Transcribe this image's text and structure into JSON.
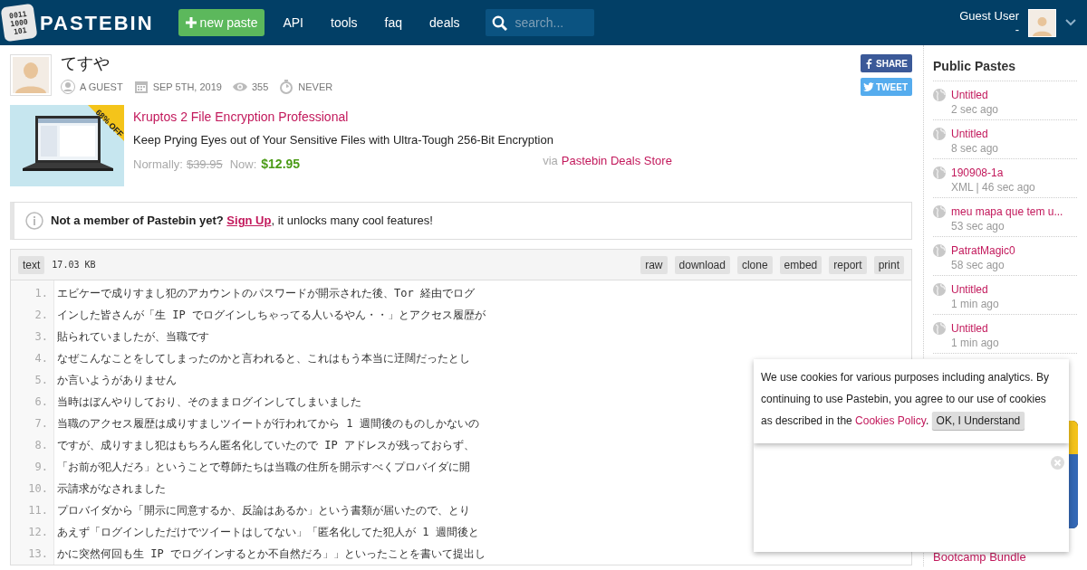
{
  "header": {
    "logo_icon_text": [
      "0011",
      "1000",
      "101"
    ],
    "logo": "PASTEBIN",
    "new_paste": "new paste",
    "nav": [
      "API",
      "tools",
      "faq",
      "deals"
    ],
    "search": {
      "placeholder": "search..."
    },
    "user": {
      "name": "Guest User",
      "sub": "-"
    }
  },
  "paste": {
    "title": "てすや",
    "meta": [
      {
        "kind": "user",
        "text": "A GUEST"
      },
      {
        "kind": "date",
        "text": "SEP 5TH, 2019"
      },
      {
        "kind": "views",
        "text": "355"
      },
      {
        "kind": "expire",
        "text": "NEVER"
      }
    ],
    "share": [
      {
        "kind": "facebook",
        "label": "SHARE"
      },
      {
        "kind": "twitter",
        "label": "TWEET"
      }
    ]
  },
  "deal": {
    "badge": "68% OFF",
    "title": "Kruptos 2 File Encryption Professional",
    "subtitle": "Keep Prying Eyes out of Your Sensitive Files with Ultra-Tough 256-Bit Encryption",
    "normally_label": "Normally:",
    "old_price": "$39.95",
    "now_label": "Now:",
    "price": "$12.95",
    "via": "via",
    "store": "Pastebin Deals Store"
  },
  "notice": {
    "bold": "Not a member of Pastebin yet?",
    "link": "Sign Up",
    "rest": ", it unlocks many cool features!"
  },
  "code": {
    "syntax": "text",
    "size": "17.03 KB",
    "actions": [
      "raw",
      "download",
      "clone",
      "embed",
      "report",
      "print"
    ],
    "lines": [
      {
        "num": "1.",
        "text": "エビケーで成りすまし犯のアカウントのパスワードが開示された後、Tor 経由でログ"
      },
      {
        "num": "2.",
        "text": "インした皆さんが「生 IP でログインしちゃってる人いるやん・・」とアクセス履歴が"
      },
      {
        "num": "3.",
        "text": "貼られていましたが、当職です"
      },
      {
        "num": "4.",
        "text": "なぜこんなことをしてしまったのかと言われると、これはもう本当に迂闊だったとし"
      },
      {
        "num": "5.",
        "text": "か言いようがありません"
      },
      {
        "num": "6.",
        "text": "当時はぼんやりしており、そのままログインしてしまいました"
      },
      {
        "num": "7.",
        "text": "当職のアクセス履歴は成りすましツイートが行われてから 1 週間後のものしかないの"
      },
      {
        "num": "8.",
        "text": "ですが、成りすまし犯はもちろん匿名化していたので IP アドレスが残っておらず、"
      },
      {
        "num": "9.",
        "text": "「お前が犯人だろ」ということで尊師たちは当職の住所を開示すべくプロバイダに開"
      },
      {
        "num": "10.",
        "text": "示請求がなされました"
      },
      {
        "num": "11.",
        "text": "プロバイダから「開示に同意するか、反論はあるか」という書類が届いたので、とり"
      },
      {
        "num": "12.",
        "text": "あえず「ログインしただけでツイートはしてない」「匿名化してた犯人が 1 週間後と"
      },
      {
        "num": "13.",
        "text": "かに突然何回も生 IP でログインするとか不自然だろ」」といったことを書いて提出し"
      }
    ]
  },
  "sidebar": {
    "title": "Public Pastes",
    "items": [
      {
        "title": "Untitled",
        "info": "2 sec ago"
      },
      {
        "title": "Untitled",
        "info": "8 sec ago"
      },
      {
        "title": "190908-1a",
        "info": "XML | 46 sec ago"
      },
      {
        "title": "meu mapa que tem u...",
        "info": "53 sec ago"
      },
      {
        "title": "PatratMagic0",
        "info": "58 sec ago"
      },
      {
        "title": "Untitled",
        "info": "1 min ago"
      },
      {
        "title": "Untitled",
        "info": "1 min ago"
      }
    ],
    "ad_caption": "Bootcamp Bundle"
  },
  "cookie": {
    "text": "We use cookies for various purposes including analytics. By continuing to use Pastebin, you agree to our use of cookies as described in the",
    "link": "Cookies Policy",
    "after": ".",
    "button": "OK, I Understand"
  }
}
